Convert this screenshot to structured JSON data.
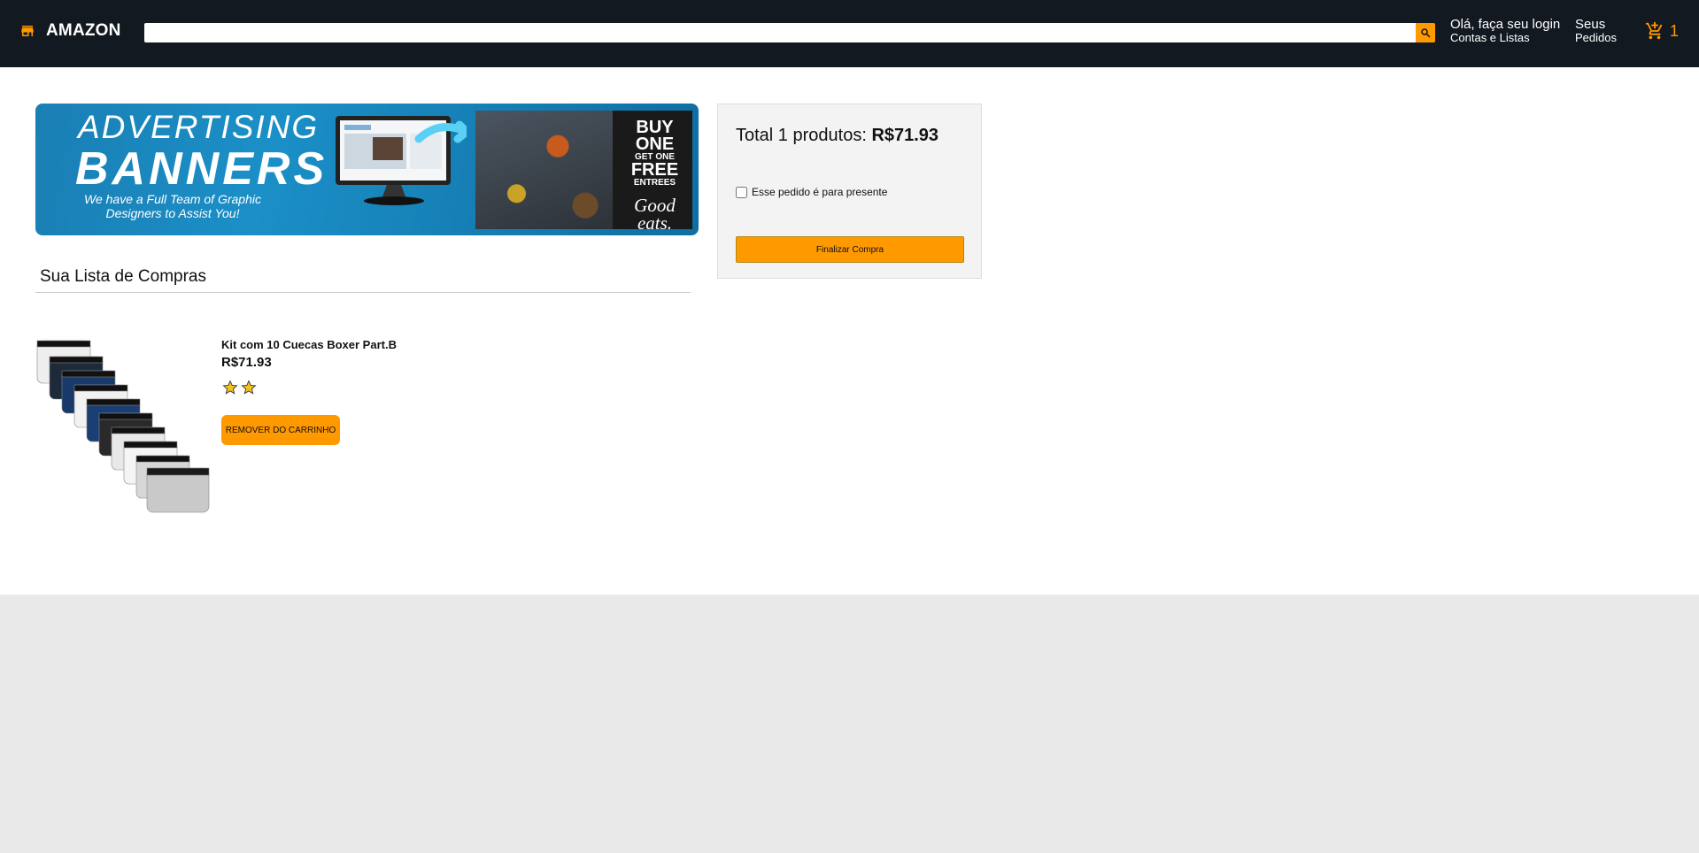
{
  "header": {
    "logo_text": "AMAZON",
    "logo_icon": "store-icon",
    "search": {
      "value": "",
      "placeholder": "",
      "button_icon": "search-icon"
    },
    "login": {
      "line1": "Olá, faça seu login",
      "line2": "Contas e Listas"
    },
    "orders": {
      "line1": "Seus",
      "line2": "Pedidos"
    },
    "cart": {
      "icon": "cart-icon",
      "count": "1"
    }
  },
  "banner": {
    "title_line1": "ADVERTISING",
    "title_line2": "BANNERS",
    "subtitle": "We have a Full Team of Graphic Designers to Assist You!",
    "promo_line1": "BUY",
    "promo_line2": "ONE",
    "promo_line3": "GET ONE",
    "promo_line4": "FREE",
    "promo_line5": "ENTREES",
    "promo_script": "Good eats."
  },
  "cart_list": {
    "title": "Sua Lista de Compras",
    "items": [
      {
        "name": "Kit com 10 Cuecas Boxer Part.B",
        "price": "R$71.93",
        "rating": 2,
        "remove_label": "REMOVER DO CARRINHO"
      }
    ]
  },
  "summary": {
    "total_prefix": "Total 1 produtos:",
    "total_value": "R$71.93",
    "gift_label": "Esse pedido é para presente",
    "checkout_label": "Finalizar Compra"
  },
  "colors": {
    "header_bg": "#131921",
    "accent": "#ff9900",
    "page_bg": "#eae9ea"
  }
}
